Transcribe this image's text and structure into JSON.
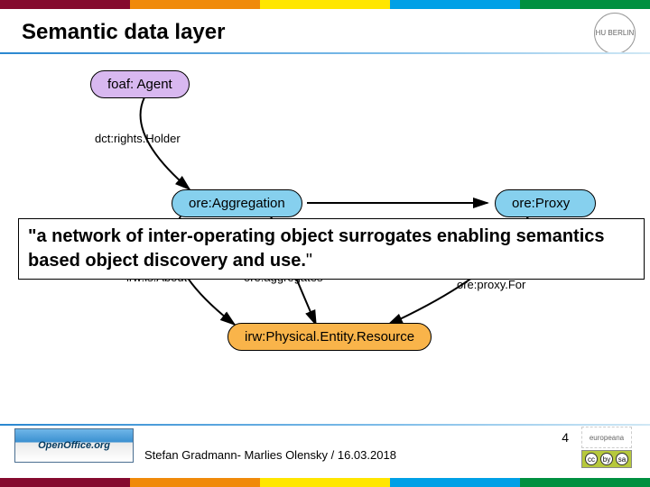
{
  "title": "Semantic data layer",
  "university_seal_text": "HU BERLIN",
  "nodes": {
    "agent": "foaf: Agent",
    "aggregation": "ore:Aggregation",
    "proxy": "ore:Proxy",
    "entity": "irw:Physical.Entity.Resource"
  },
  "edges": {
    "rightsHolder": "dct:rights.Holder",
    "isAbout": "irw:is.About",
    "aggregates": "ore:aggregates",
    "proxyFor": "ore:proxy.For"
  },
  "quote": {
    "main": "\"a network of inter-operating object surrogates enabling semantics based object discovery and use.",
    "tail": "\""
  },
  "footer": {
    "openoffice": "OpenOffice.org",
    "credit": "Stefan Gradmann- Marlies Olensky / 16.03.2018",
    "page": "4",
    "europeana": "europeana",
    "cc": "CC BY-SA"
  }
}
